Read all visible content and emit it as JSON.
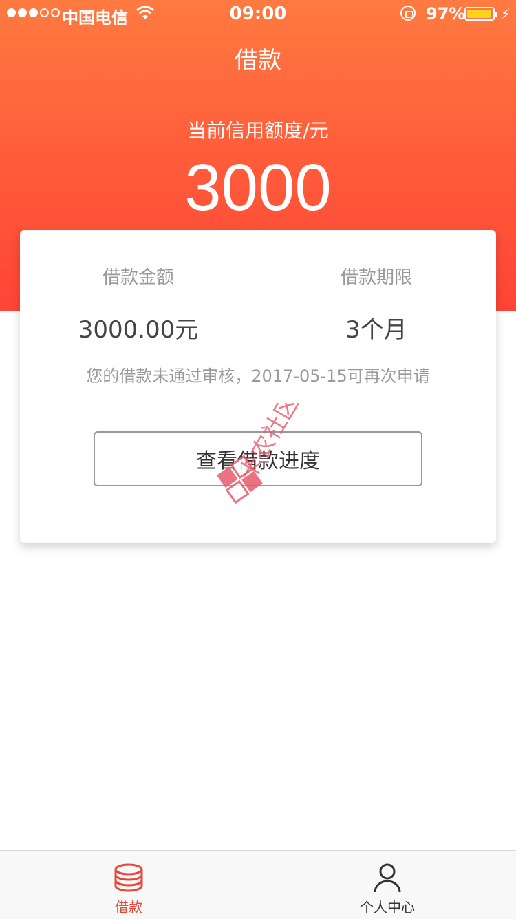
{
  "status_bar": {
    "carrier": "中国电信",
    "time": "09:00",
    "battery_percent": "97%",
    "battery_level": 0.97
  },
  "nav": {
    "title": "借款"
  },
  "credit": {
    "label": "当前信用额度/元",
    "amount": "3000"
  },
  "card": {
    "amount_label": "借款金额",
    "amount_value": "3000.00元",
    "term_label": "借款期限",
    "term_value": "3个月",
    "notice": "您的借款未通过审核，2017-05-15可再次申请",
    "button_label": "查看借款进度",
    "watermark_text": "卡农社区"
  },
  "tabs": [
    {
      "label": "借款",
      "icon": "coins-stack-icon",
      "active": true
    },
    {
      "label": "个人中心",
      "icon": "person-icon",
      "active": false
    }
  ],
  "colors": {
    "header_top": "#ff7a40",
    "header_bottom": "#ff4436",
    "active_tab": "#e8473a",
    "battery_fill": "#ffd21f"
  }
}
